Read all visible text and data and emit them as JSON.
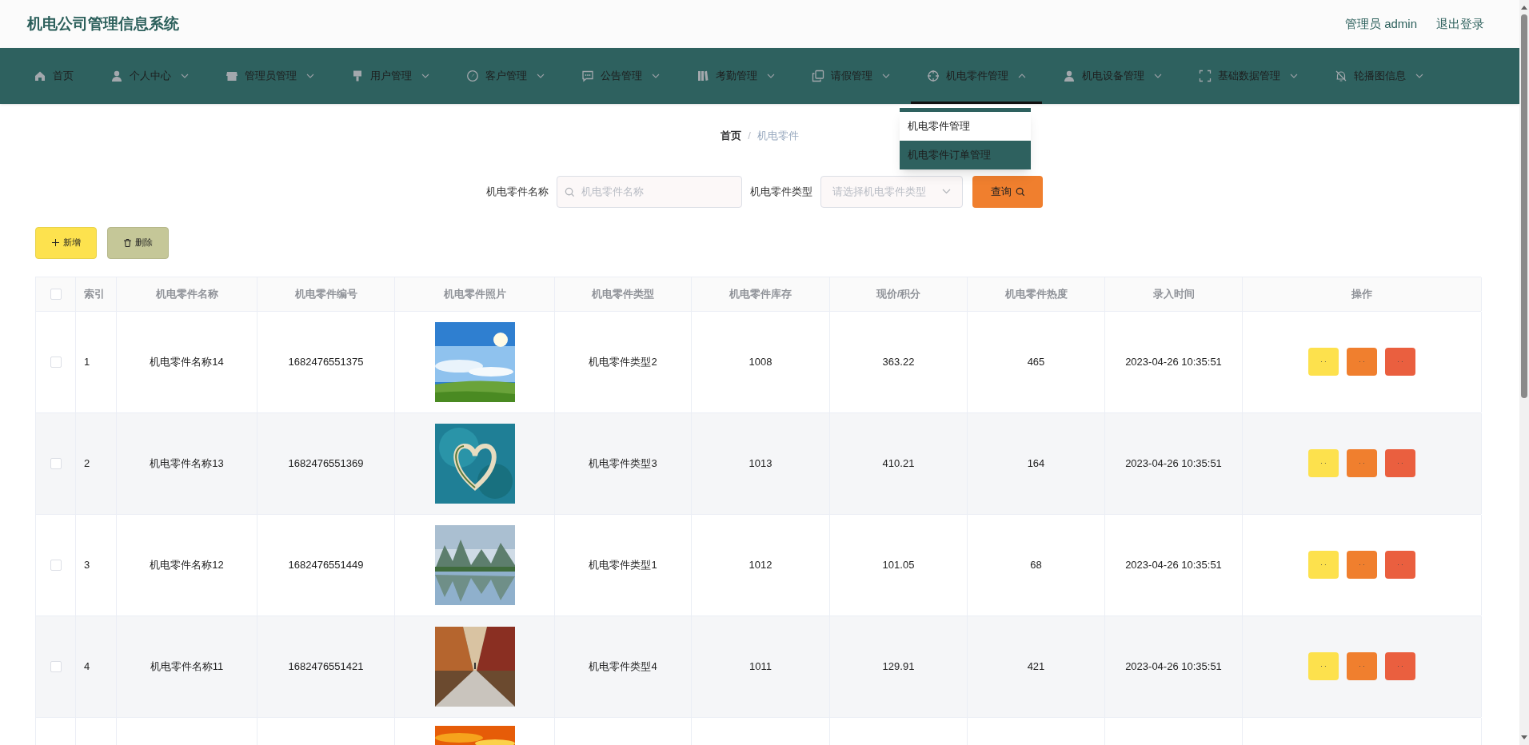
{
  "header": {
    "title": "机电公司管理信息系统",
    "user": "管理员 admin",
    "logout": "退出登录"
  },
  "nav": [
    {
      "label": "首页",
      "has_menu": false,
      "selected": false
    },
    {
      "label": "个人中心",
      "has_menu": true,
      "selected": false
    },
    {
      "label": "管理员管理",
      "has_menu": true,
      "selected": false
    },
    {
      "label": "用户管理",
      "has_menu": true,
      "selected": false
    },
    {
      "label": "客户管理",
      "has_menu": true,
      "selected": false
    },
    {
      "label": "公告管理",
      "has_menu": true,
      "selected": false
    },
    {
      "label": "考勤管理",
      "has_menu": true,
      "selected": false
    },
    {
      "label": "请假管理",
      "has_menu": true,
      "selected": false
    },
    {
      "label": "机电零件管理",
      "has_menu": true,
      "selected": true,
      "expanded": true,
      "submenu": [
        {
          "label": "机电零件管理",
          "highlighted": false
        },
        {
          "label": "机电零件订单管理",
          "highlighted": true
        }
      ]
    },
    {
      "label": "机电设备管理",
      "has_menu": true,
      "selected": false
    },
    {
      "label": "基础数据管理",
      "has_menu": true,
      "selected": false
    },
    {
      "label": "轮播图信息",
      "has_menu": true,
      "selected": false
    }
  ],
  "breadcrumb": {
    "items": [
      "首页",
      "机电零件"
    ],
    "separator": "/"
  },
  "search": {
    "name_label": "机电零件名称",
    "name_placeholder": "机电零件名称",
    "type_label": "机电零件类型",
    "type_placeholder": "请选择机电零件类型",
    "query_button": "查询"
  },
  "toolbar": {
    "add": "新增",
    "delete": "删除"
  },
  "table": {
    "select_all_checked": false,
    "columns": [
      "索引",
      "机电零件名称",
      "机电零件编号",
      "机电零件照片",
      "机电零件类型",
      "机电零件库存",
      "现价/积分",
      "机电零件热度",
      "录入时间",
      "操作"
    ],
    "actions": [
      {
        "label": "· ·",
        "color": "#fde14d"
      },
      {
        "label": "· ·",
        "color": "#f07f2e"
      },
      {
        "label": "· ·",
        "color": "#ea5f3f"
      }
    ],
    "rows": [
      {
        "checked": false,
        "index": "1",
        "name": "机电零件名称14",
        "code": "1682476551375",
        "photo": {
          "kind": "picture"
        },
        "type": "机电零件类型2",
        "stock": "1008",
        "price": "363.22",
        "heat": "465",
        "time": "2023-04-26 10:35:51"
      },
      {
        "checked": false,
        "index": "2",
        "name": "机电零件名称13",
        "code": "1682476551369",
        "photo": {
          "kind": "picture"
        },
        "type": "机电零件类型3",
        "stock": "1013",
        "price": "410.21",
        "heat": "164",
        "time": "2023-04-26 10:35:51"
      },
      {
        "checked": false,
        "index": "3",
        "name": "机电零件名称12",
        "code": "1682476551449",
        "photo": {
          "kind": "picture"
        },
        "type": "机电零件类型1",
        "stock": "1012",
        "price": "101.05",
        "heat": "68",
        "time": "2023-04-26 10:35:51"
      },
      {
        "checked": false,
        "index": "4",
        "name": "机电零件名称11",
        "code": "1682476551421",
        "photo": {
          "kind": "picture"
        },
        "type": "机电零件类型4",
        "stock": "1011",
        "price": "129.91",
        "heat": "421",
        "time": "2023-04-26 10:35:51"
      },
      {
        "photo": {
          "kind": "picture"
        }
      }
    ]
  }
}
